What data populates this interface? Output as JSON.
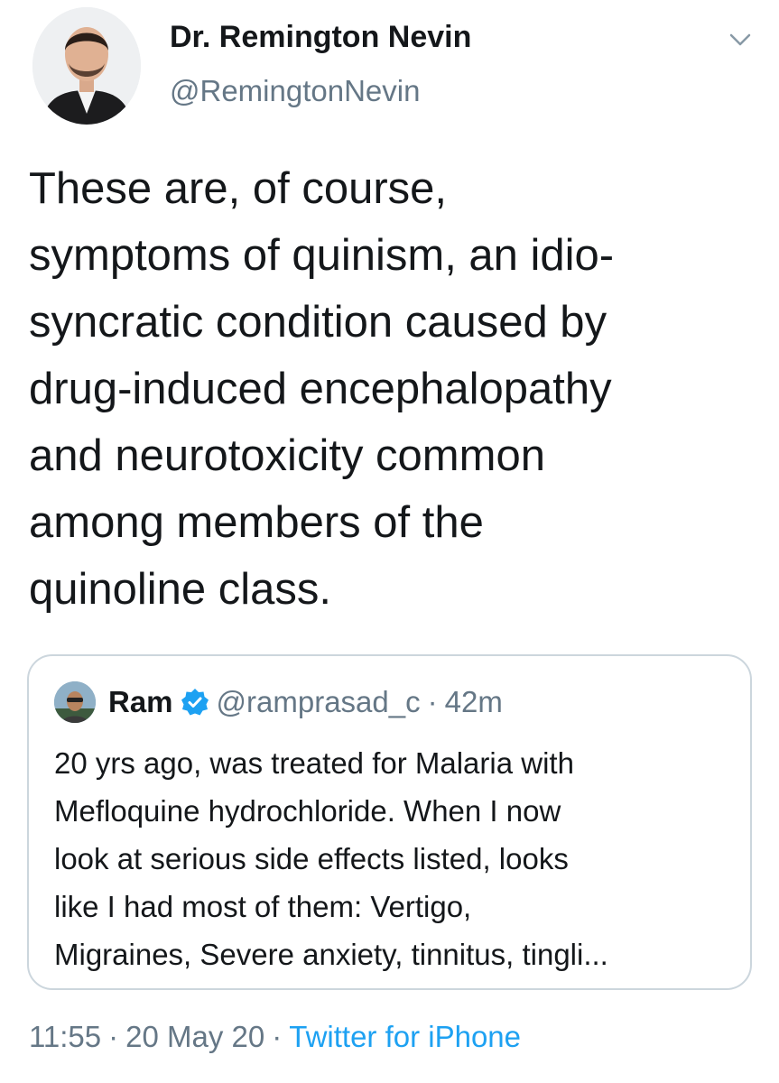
{
  "author": {
    "name": "Dr. Remington Nevin",
    "handle": "@RemingtonNevin"
  },
  "tweet": {
    "lines": [
      "These are, of course,",
      "symptoms of quinism, an idio-",
      "syncratic condition caused by",
      "drug-induced encephalopathy",
      "and neurotoxicity common",
      "among members of the",
      "quinoline class."
    ]
  },
  "quoted_tweet": {
    "name": "Ram",
    "handle": "@ramprasad_c",
    "separator": "·",
    "time": "42m",
    "verified": true,
    "lines": [
      "20 yrs ago, was treated for Malaria with",
      "Mefloquine hydrochloride. When I now",
      "look at serious side effects listed, looks",
      "like I had most of them: Vertigo,",
      "Migraines, Severe anxiety, tinnitus, tingli..."
    ]
  },
  "meta": {
    "time": "11:55",
    "separator": "·",
    "date": "20 May 20",
    "separator2": "·",
    "source": "Twitter for iPhone"
  },
  "colors": {
    "text": "#14171a",
    "secondary": "#657786",
    "accent": "#1da1f2",
    "border": "#ccd6dd"
  },
  "icons": {
    "menu": "chevron-down-icon",
    "verified": "verified-badge-icon"
  }
}
